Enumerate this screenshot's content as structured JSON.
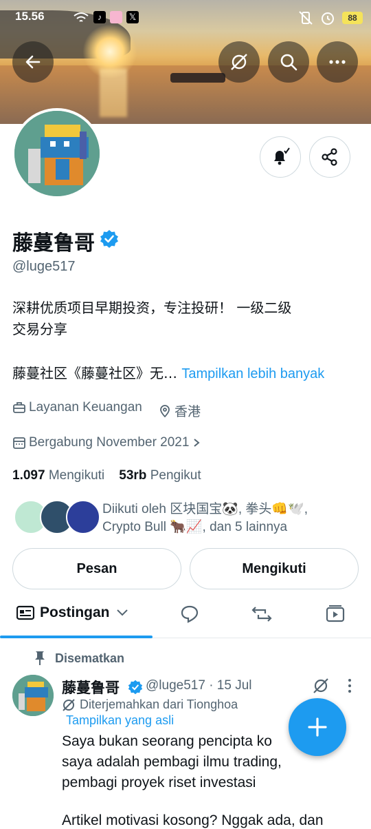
{
  "status_bar": {
    "time": "15.56",
    "battery": "88"
  },
  "profile": {
    "display_name": "藤蔓鲁哥",
    "handle": "@luge517",
    "bio_line1": "深耕优质项目早期投资，专注投研！ 一级二级",
    "bio_line2": "交易分享",
    "bio_truncated": "藤蔓社区《藤蔓社区》无…",
    "show_more": "Tampilkan lebih banyak",
    "category": "Layanan Keuangan",
    "location": "香港",
    "joined": "Bergabung November 2021",
    "following_count": "1.097",
    "following_label": "Mengikuti",
    "followers_count": "53rb",
    "followers_label": "Pengikut",
    "followed_by_line1": "Diikuti oleh 区块国宝🐼, 拳头👊🕊️,",
    "followed_by_line2": "Crypto Bull 🐂📈, dan 5 lainnya"
  },
  "actions": {
    "message": "Pesan",
    "following": "Mengikuti"
  },
  "tabs": {
    "posts": "Postingan"
  },
  "post": {
    "pinned_label": "Disematkan",
    "author_name": "藤蔓鲁哥",
    "author_meta": "@luge517 · 15 Jul",
    "translated_label": "Diterjemahkan dari Tionghoa",
    "show_original": "Tampilkan yang asli",
    "text_line1": "Saya bukan seorang pencipta ko",
    "text_line2": "saya adalah pembagi ilmu trading,",
    "text_line3": "pembagi proyek riset investasi",
    "text_line4": "Artikel motivasi kosong? Nggak ada, dan"
  },
  "colors": {
    "accent": "#1d9bf0",
    "text": "#0f1419",
    "muted": "#536471"
  }
}
